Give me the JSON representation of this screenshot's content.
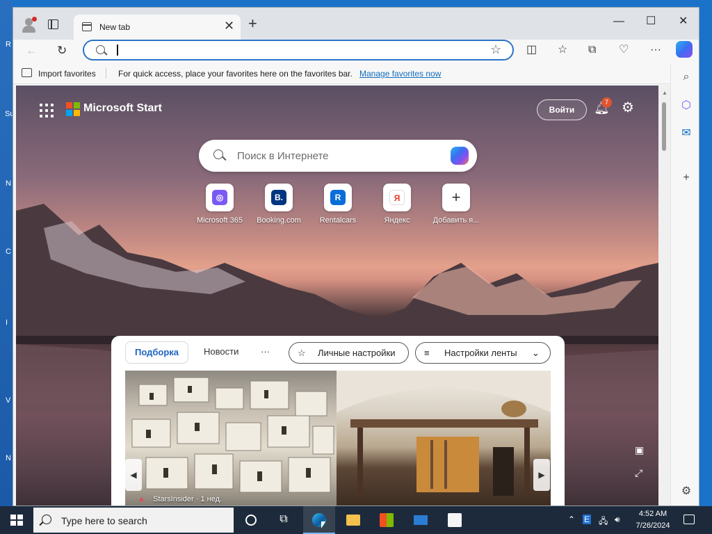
{
  "desktop": {
    "letters": [
      "R",
      "Su",
      "N",
      "C",
      "I",
      "V",
      "N"
    ]
  },
  "browser": {
    "tab": {
      "title": "New tab",
      "close": "✕"
    },
    "window_controls": {
      "minimize": "—",
      "maximize": "☐",
      "close": "✕"
    },
    "address_bar": {
      "value": ""
    },
    "favorites_bar": {
      "import_label": "Import favorites",
      "hint": "For quick access, place your favorites here on the favorites bar.",
      "manage_link": "Manage favorites now"
    }
  },
  "start_page": {
    "brand": "Microsoft Start",
    "login_label": "Войти",
    "notifications_count": "7",
    "search_placeholder": "Поиск в Интернете",
    "quick_links": [
      {
        "label": "Microsoft 365",
        "icon": "microsoft365-icon",
        "glyph": "◎",
        "color": "#7a5af5"
      },
      {
        "label": "Booking.com",
        "icon": "booking-icon",
        "glyph": "B.",
        "color": "#003580"
      },
      {
        "label": "Rentalcars",
        "icon": "rentalcars-icon",
        "glyph": "R",
        "color": "#0a6dd9"
      },
      {
        "label": "Яндекс",
        "icon": "yandex-icon",
        "glyph": "Я",
        "color": "#e8372c"
      },
      {
        "label": "Добавить я...",
        "icon": "add-icon",
        "glyph": "+",
        "color": "#333333"
      }
    ],
    "feed": {
      "tabs": [
        "Подборка",
        "Новости",
        "···"
      ],
      "personalize_label": "Личные настройки",
      "feed_settings_label": "Настройки ленты",
      "card_source": "StarsInsider · 1 нед."
    }
  },
  "taskbar": {
    "search_placeholder": "Type here to search",
    "time": "4:52 AM",
    "date": "7/26/2024"
  },
  "colors": {
    "accent": "#0f6cbd",
    "taskbar": "#1d2a3b",
    "badge": "#e0542f"
  }
}
